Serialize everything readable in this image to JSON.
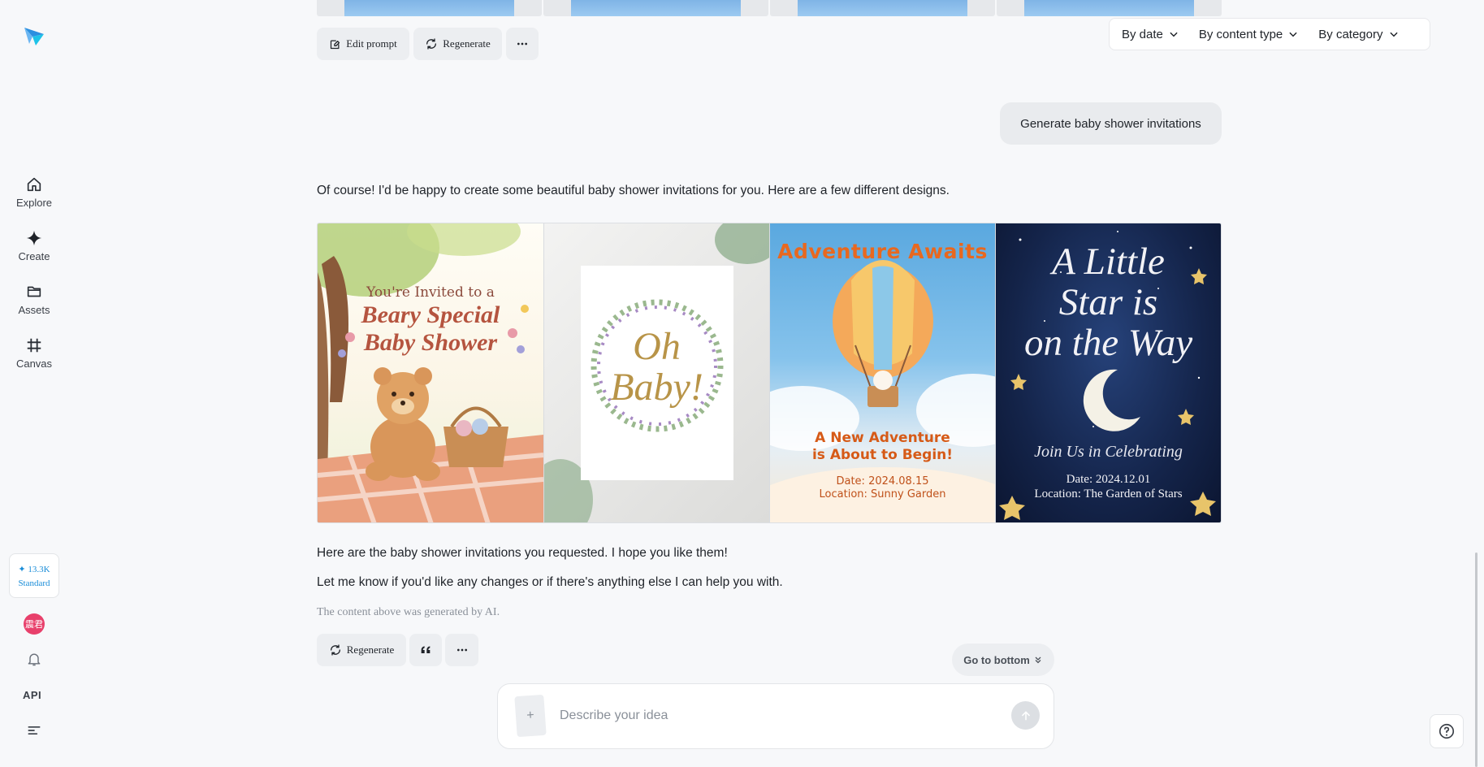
{
  "sidebar": {
    "logo_icon": "paper-plane-logo-icon",
    "items": [
      {
        "label": "Explore",
        "icon": "home-icon"
      },
      {
        "label": "Create",
        "icon": "sparkle-icon"
      },
      {
        "label": "Assets",
        "icon": "folder-icon"
      },
      {
        "label": "Canvas",
        "icon": "frame-icon"
      }
    ],
    "credits": {
      "amount": "✦ 13.3K",
      "plan": "Standard"
    },
    "avatar_text": "震君",
    "api_label": "API"
  },
  "filters": [
    "By date",
    "By content type",
    "By category"
  ],
  "previous_actions": {
    "edit_prompt": "Edit prompt",
    "regenerate": "Regenerate"
  },
  "conversation": {
    "user_message": "Generate baby shower invitations",
    "assistant_intro": "Of course! I'd be happy to create some beautiful baby shower invitations for you. Here are a few different designs.",
    "images": [
      {
        "line1": "You're Invited to a",
        "line2": "Beary Special",
        "line3": "Baby Shower"
      },
      {
        "line1": "Oh",
        "line2": "Baby!"
      },
      {
        "title": "Adventure Awaits",
        "sub1": "A New Adventure",
        "sub2": "is About to Begin!",
        "date": "Date: 2024.08.15",
        "location": "Location: Sunny Garden"
      },
      {
        "line1": "A Little",
        "line2": "Star is",
        "line3": "on the Way",
        "sub": "Join Us in Celebrating",
        "date": "Date: 2024.12.01",
        "location": "Location: The Garden of Stars"
      }
    ],
    "assistant_outro_1": "Here are the baby shower invitations you requested. I hope you like them!",
    "assistant_outro_2": "Let me know if you'd like any changes or if there's anything else I can help you with.",
    "ai_note": "The content above was generated by AI."
  },
  "message_actions": {
    "regenerate": "Regenerate",
    "quote_icon": "quote-icon",
    "more_icon": "more-icon"
  },
  "go_to_bottom": "Go to bottom",
  "composer": {
    "placeholder": "Describe your idea",
    "value": ""
  },
  "colors": {
    "accent": "#1a8dd8",
    "avatar": "#e8406b",
    "background": "#f7f8fa"
  }
}
